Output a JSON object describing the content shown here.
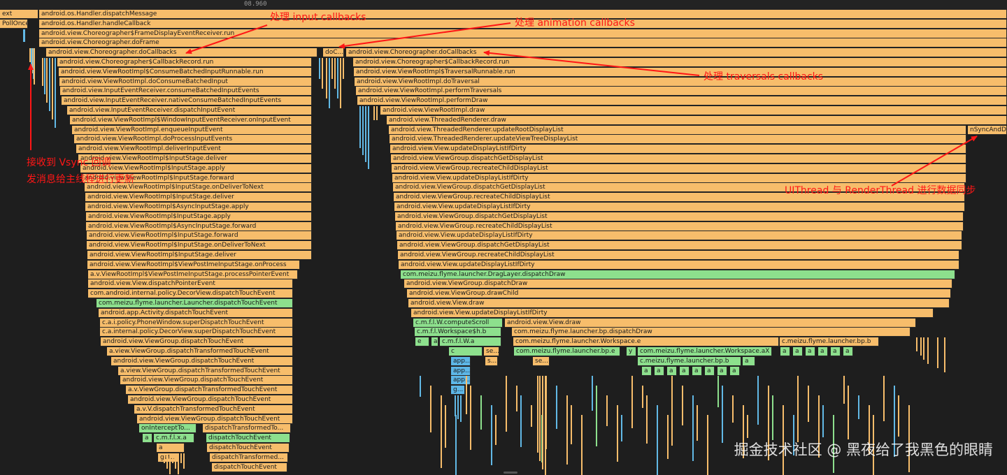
{
  "timeline": {
    "timestamp": "08.960"
  },
  "stacks": {
    "main_top": [
      "ext",
      "android.os.Handler.dispatchMessage"
    ],
    "poll": "PollOnce",
    "handle_callback": "android.os.Handler.handleCallback",
    "frame_receiver": "android.view.Choreographer$FrameDisplayEventReceiver.run",
    "do_frame": "android.view.Choreographer.doFrame",
    "input_stack": [
      "android.view.Choreographer.doCallbacks",
      "android.view.Choreographer$CallbackRecord.run",
      "android.view.ViewRootImpl$ConsumeBatchedInputRunnable.run",
      "android.view.ViewRootImpl.doConsumeBatchedInput",
      "android.view.InputEventReceiver.consumeBatchedInputEvents",
      "android.view.InputEventReceiver.nativeConsumeBatchedInputEvents",
      "android.view.InputEventReceiver.dispatchInputEvent",
      "android.view.ViewRootImpl$WindowInputEventReceiver.onInputEvent",
      "android.view.ViewRootImpl.enqueueInputEvent",
      "android.view.ViewRootImpl.doProcessInputEvents",
      "android.view.ViewRootImpl.deliverInputEvent",
      "android.view.ViewRootImpl$InputStage.deliver",
      "android.view.ViewRootImpl$InputStage.apply",
      "android.view.ViewRootImpl$InputStage.forward",
      "android.view.ViewRootImpl$InputStage.onDeliverToNext",
      "android.view.ViewRootImpl$InputStage.deliver",
      "android.view.ViewRootImpl$AsyncInputStage.apply",
      "android.view.ViewRootImpl$InputStage.apply",
      "android.view.ViewRootImpl$AsyncInputStage.forward",
      "android.view.ViewRootImpl$InputStage.forward",
      "android.view.ViewRootImpl$InputStage.onDeliverToNext",
      "android.view.ViewRootImpl$InputStage.deliver",
      "android.view.ViewRootImpl$ViewPostImeInputStage.onProcess",
      "a.v.ViewRootImpl$ViewPostImeInputStage.processPointerEvent",
      "android.view.View.dispatchPointerEvent",
      "com.android.internal.policy.DecorView.dispatchTouchEvent",
      "com.meizu.flyme.launcher.Launcher.dispatchTouchEvent",
      "android.app.Activity.dispatchTouchEvent",
      "c.a.i.policy.PhoneWindow.superDispatchTouchEvent",
      "c.a.internal.policy.DecorView.superDispatchTouchEvent",
      "android.view.ViewGroup.dispatchTouchEvent",
      "a.view.ViewGroup.dispatchTransformedTouchEvent",
      "android.view.ViewGroup.dispatchTouchEvent",
      "a.view.ViewGroup.dispatchTransformedTouchEvent",
      "android.view.ViewGroup.dispatchTouchEvent",
      "a.v.ViewGroup.dispatchTransformedTouchEvent",
      "android.view.ViewGroup.dispatchTouchEvent",
      "a.v.V.dispatchTransformedTouchEvent",
      "android.view.ViewGroup.dispatchTouchEvent"
    ],
    "input_leaves": [
      "onInterceptTo...",
      "dispatchTransformedTo...",
      "a",
      "c.m.f.l.x.a",
      "dispatchTouchEvent",
      "a",
      "dispatchTouchEvent",
      "get...",
      "dispatchTransformed...",
      "dispatchTouchEvent"
    ],
    "anim": {
      "do_callbacks": "doC...",
      "small": "g"
    },
    "traversal_stack": [
      "android.view.Choreographer.doCallbacks",
      "android.view.Choreographer$CallbackRecord.run",
      "android.view.ViewRootImpl$TraversalRunnable.run",
      "android.view.ViewRootImpl.doTraversal",
      "android.view.ViewRootImpl.performTraversals",
      "android.view.ViewRootImpl.performDraw",
      "android.view.ViewRootImpl.draw",
      "android.view.ThreadedRenderer.draw",
      "android.view.ThreadedRenderer.updateRootDisplayList",
      "android.view.ThreadedRenderer.updateViewTreeDisplayList",
      "android.view.View.updateDisplayListIfDirty",
      "android.view.ViewGroup.dispatchGetDisplayList",
      "android.view.ViewGroup.recreateChildDisplayList",
      "android.view.View.updateDisplayListIfDirty",
      "android.view.ViewGroup.dispatchGetDisplayList",
      "android.view.ViewGroup.recreateChildDisplayList",
      "android.view.View.updateDisplayListIfDirty",
      "android.view.ViewGroup.dispatchGetDisplayList",
      "android.view.ViewGroup.recreateChildDisplayList",
      "android.view.View.updateDisplayListIfDirty",
      "android.view.ViewGroup.dispatchGetDisplayList",
      "android.view.ViewGroup.recreateChildDisplayList",
      "android.view.View.updateDisplayListIfDirty",
      "com.meizu.flyme.launcher.DragLayer.dispatchDraw",
      "android.view.ViewGroup.dispatchDraw",
      "android.view.ViewGroup.drawChild",
      "android.view.View.draw",
      "android.view.View.updateDisplayListIfDirty"
    ],
    "sync": "nSyncAndD",
    "traversal_leaves": {
      "compute_scroll": "c.m.f.l.W.computeScroll",
      "view_draw": "android.view.View.draw",
      "workspace_h_b": "c.m.f.l.Workspace$h.b",
      "bp_dispatch": "com.meizu.flyme.launcher.bp.dispatchDraw",
      "e": "e",
      "a": "a",
      "w_a": "c.m.f.l.W.a",
      "workspace_e": "com.meizu.flyme.launcher.Workspace.e",
      "bp_b": "c.meizu.flyme.launcher.bp.b",
      "c": "c",
      "se": "se...",
      "bp_e": "com.meizu.flyme.launcher.bp.e",
      "y": "y",
      "workspace_ax": "com.meizu.flyme.launcher.Workspace.aX",
      "bp_b2": "c.meizu.flyme.launcher.bp.b",
      "app": "app...",
      "g": "g...",
      "s": "s..."
    }
  },
  "annotations": {
    "input": "处理 input callbacks",
    "animation": "处理 animation callbacks",
    "traversal": "处理 traversals callbacks",
    "vsync": "接收到 Vsync 回调",
    "vsync2": "发消息给主线程进行更新",
    "sync": "UIThread 与 RenderThread 进行数据同步"
  },
  "watermark": "掘金技术社区 @ 黑夜给了我黑色的眼睛",
  "colors": {
    "java_frame": "#f7bd6b",
    "app_frame": "#8de08d",
    "native_frame": "#5db7e8",
    "annotation": "#ff1616",
    "background": "#1e1e1e"
  }
}
